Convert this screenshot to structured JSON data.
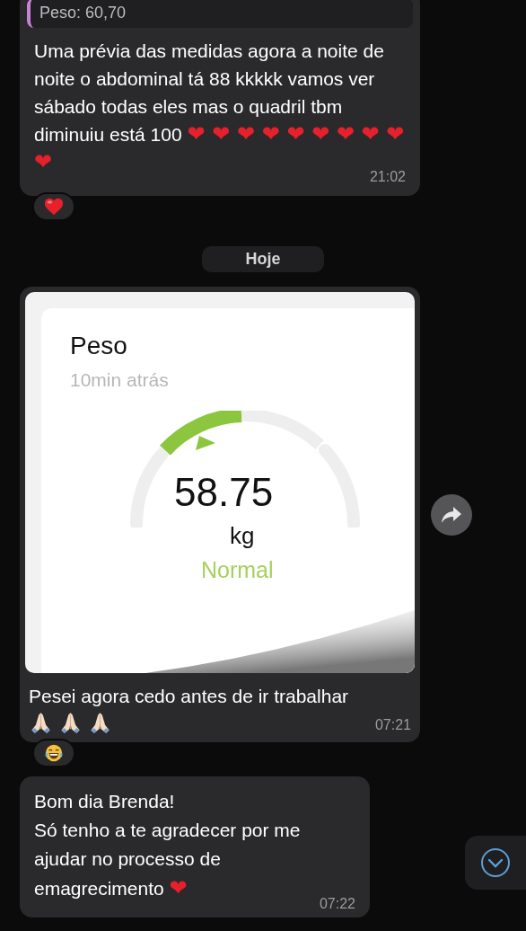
{
  "messages": [
    {
      "kind": "text",
      "quote": {
        "text": "Peso: 60,70"
      },
      "text": "Uma prévia das medidas agora a noite de noite o abdominal tá 88 kkkkk vamos ver sábado todas eles mas o quadril tbm diminuiu está 100",
      "hearts": "❤ ❤ ❤ ❤ ❤ ❤ ❤ ❤ ❤ ❤",
      "time": "21:02",
      "reaction": {
        "kind": "heart"
      }
    },
    {
      "kind": "date",
      "label": "Hoje"
    },
    {
      "kind": "image",
      "card": {
        "title": "Peso",
        "subtitle": "10min atrás",
        "value": "58.75",
        "unit": "kg",
        "status": "Normal"
      },
      "text": "Pesei agora cedo antes de ir trabalhar",
      "emojis": [
        {
          "kind": "pray"
        },
        {
          "kind": "pray"
        },
        {
          "kind": "pray"
        }
      ],
      "time": "07:21",
      "reaction": {
        "kind": "laugh"
      }
    },
    {
      "kind": "text",
      "text": "Bom dia Brenda!\nSó tenho a te agradecer por me ajudar no processo de emagrecimento",
      "hearts": "❤",
      "time": "07:22"
    }
  ]
}
